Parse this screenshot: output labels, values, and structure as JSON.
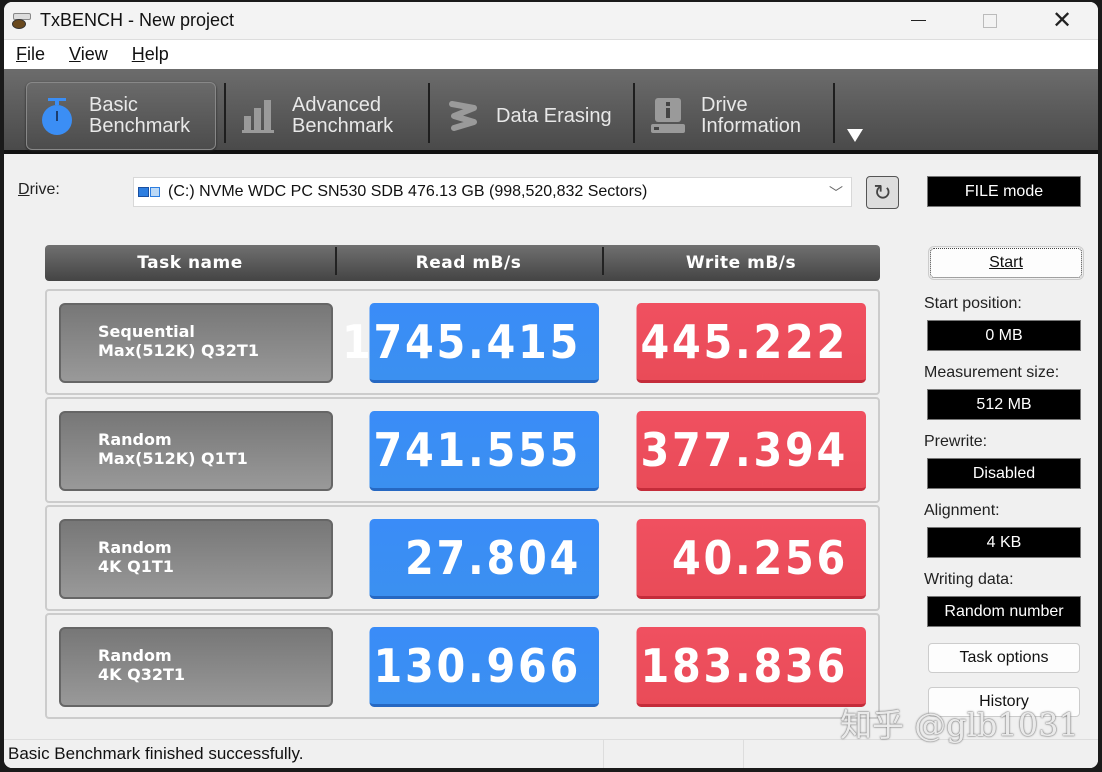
{
  "window": {
    "title": "TxBENCH - New project",
    "icon": "app-icon"
  },
  "menu": [
    {
      "label": "File",
      "mnemonic": "F",
      "rest": "ile"
    },
    {
      "label": "View",
      "mnemonic": "V",
      "rest": "iew"
    },
    {
      "label": "Help",
      "mnemonic": "H",
      "rest": "elp"
    }
  ],
  "toolbar": {
    "tabs": [
      {
        "line1": "Basic",
        "line2": "Benchmark",
        "icon": "stopwatch-icon",
        "active": true
      },
      {
        "line1": "Advanced",
        "line2": "Benchmark",
        "icon": "bar-chart-icon",
        "active": false
      },
      {
        "line1": "Data Erasing",
        "line2": "",
        "icon": "eraser-icon",
        "active": false
      },
      {
        "line1": "Drive",
        "line2": "Information",
        "icon": "drive-info-icon",
        "active": false
      }
    ],
    "more_icon": "dropdown-triangle-icon"
  },
  "drive": {
    "label": "Drive:",
    "selected": "(C:) NVMe WDC PC SN530 SDB  476.13 GB (998,520,832 Sectors)",
    "refresh_icon": "refresh-icon"
  },
  "mode": "FILE mode",
  "table": {
    "headers": [
      "Task name",
      "Read mB/s",
      "Write mB/s"
    ],
    "rows": [
      {
        "line1": "Sequential",
        "line2": "Max(512K) Q32T1",
        "read": "1745.415",
        "write": "445.222"
      },
      {
        "line1": "Random",
        "line2": "Max(512K) Q1T1",
        "read": "741.555",
        "write": "377.394"
      },
      {
        "line1": "Random",
        "line2": "4K Q1T1",
        "read": "27.804",
        "write": "40.256"
      },
      {
        "line1": "Random",
        "line2": "4K Q32T1",
        "read": "130.966",
        "write": "183.836"
      }
    ]
  },
  "side": {
    "start_button": "Start",
    "start_position_label": "Start position:",
    "start_position": "0 MB",
    "measurement_size_label": "Measurement size:",
    "measurement_size": "512 MB",
    "prewrite_label": "Prewrite:",
    "prewrite": "Disabled",
    "alignment_label": "Alignment:",
    "alignment": "4 KB",
    "writing_data_label": "Writing data:",
    "writing_data": "Random number",
    "task_options_button": "Task options",
    "history_button": "History"
  },
  "status": {
    "message": "Basic Benchmark finished successfully."
  },
  "watermark": "知乎 @glb1031",
  "colors": {
    "read": "#3b8ef5",
    "write": "#ee4e5c",
    "accent_icon": "#3b8ef5"
  }
}
